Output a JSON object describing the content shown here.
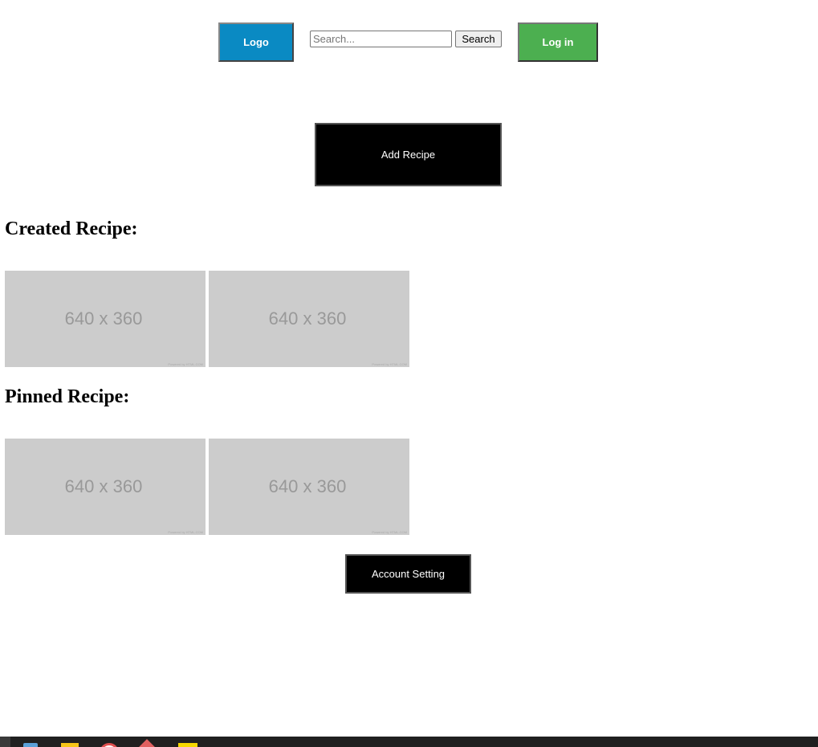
{
  "header": {
    "logo_label": "Logo",
    "search": {
      "placeholder": "Search...",
      "value": "",
      "button_label": "Search"
    },
    "login_label": "Log in"
  },
  "main": {
    "add_recipe_label": "Add Recipe",
    "created_section": {
      "title": "Created Recipe:",
      "items": [
        {
          "label": "640 x 360",
          "credit": "Powered by HTML.COM"
        },
        {
          "label": "640 x 360",
          "credit": "Powered by HTML.COM"
        }
      ]
    },
    "pinned_section": {
      "title": "Pinned Recipe:",
      "items": [
        {
          "label": "640 x 360",
          "credit": "Powered by HTML.COM"
        },
        {
          "label": "640 x 360",
          "credit": "Powered by HTML.COM"
        }
      ]
    },
    "account_setting_label": "Account Setting"
  },
  "colors": {
    "logo_bg": "#0a8ac3",
    "login_bg": "#4caf50",
    "primary_button_bg": "#000000",
    "placeholder_bg": "#cccccc",
    "taskbar_bg": "#202020"
  },
  "taskbar": {
    "icons": [
      "start-icon",
      "app-icon",
      "file-explorer-icon",
      "browser-icon",
      "app-icon",
      "app-icon"
    ]
  }
}
